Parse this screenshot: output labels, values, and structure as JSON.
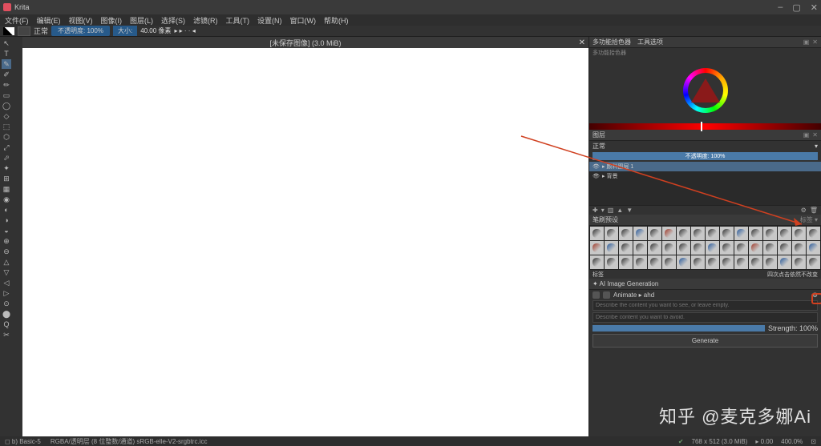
{
  "app": {
    "title": "Krita"
  },
  "window_controls": {
    "min": "–",
    "max": "▢",
    "close": "✕"
  },
  "menu": [
    "文件(F)",
    "编辑(E)",
    "视图(V)",
    "图像(I)",
    "图层(L)",
    "选择(S)",
    "滤镜(R)",
    "工具(T)",
    "设置(N)",
    "窗口(W)",
    "帮助(H)"
  ],
  "options": {
    "tool_label": "正常",
    "opacity_label": "不透明度:",
    "opacity_value": "100%",
    "size_prefix": "大小:",
    "size_value": "40.00 像素",
    "extra": "▸ ▸ · · ◂"
  },
  "document": {
    "tab_title": "[未保存图像] (3.0 MiB)",
    "close": "✕"
  },
  "dock_tabs": {
    "left": "多功能拾色器",
    "right": "工具选项"
  },
  "color_dock": {
    "sub": "多功能拾色器"
  },
  "layers": {
    "header": "图层",
    "mode": "正常",
    "opacity": "不透明度: 100%",
    "items": [
      {
        "name": "▸ 颜料图层 1",
        "selected": true
      },
      {
        "name": "▸ 背景",
        "selected": false
      }
    ],
    "buttons": "+ ▾ ▥ ▢ ▣ ⟲ ◧ ✕"
  },
  "brush_dock": {
    "header": "笔刷预设",
    "tag_label": "标签 ▾",
    "footer_left": "标签",
    "footer_right": "四次点击依然不改变"
  },
  "ai": {
    "title": "AI Image Generation",
    "animate": "Animate ▸ ahd",
    "prompt1_placeholder": "Describe the content you want to see, or leave empty.",
    "prompt2_placeholder": "Describe content you want to avoid.",
    "strength_label": "Strength: 100%",
    "generate": "Generate",
    "gear": "⚙"
  },
  "status": {
    "left": "◻ b) Basic-5",
    "center": "RGBA/透明层 (8 位整数/通道) sRGB-elle-V2-srgbtrc.icc",
    "pos": "768 x 512 (3.0 MiB)",
    "angle": "▸ 0.00",
    "zoom": "400.0%"
  },
  "watermark": "知乎 @麦克多娜Ai",
  "toolbox_icons": [
    "↖",
    "T",
    "✎",
    "✐",
    "✏",
    "▭",
    "◯",
    "◇",
    "⬚",
    "⬡",
    "⤢",
    "⬀",
    "✦",
    "⊞",
    "▦",
    "◉",
    "◐",
    "◑",
    "◒",
    "⊕",
    "⊖",
    "△",
    "▽",
    "◁",
    "▷",
    "⊙",
    "⬤",
    "Q",
    "✂"
  ]
}
